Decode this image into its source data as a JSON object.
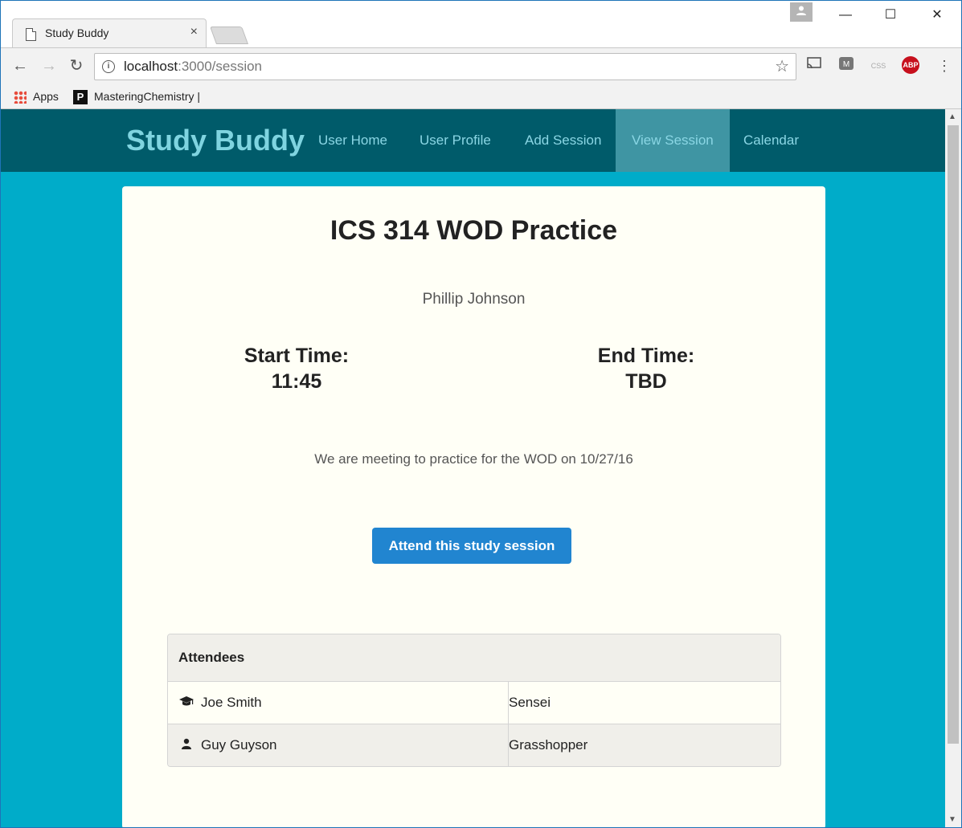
{
  "browser": {
    "tab_title": "Study Buddy",
    "tab_close": "×",
    "url_host": "localhost",
    "url_rest": ":3000/session",
    "window_controls": {
      "minimize": "—",
      "maximize": "☐",
      "close": "✕"
    },
    "bookmarks": [
      {
        "label": "Apps",
        "icon": "apps-grid-icon"
      },
      {
        "label": "MasteringChemistry |",
        "icon": "pearson-p-icon"
      }
    ],
    "extensions": {
      "abp_label": "ABP"
    }
  },
  "navbar": {
    "brand": "Study Buddy",
    "items": [
      {
        "label": "User Home",
        "active": false
      },
      {
        "label": "User Profile",
        "active": false
      },
      {
        "label": "Add Session",
        "active": false
      },
      {
        "label": "View Session",
        "active": true
      },
      {
        "label": "Calendar",
        "active": false
      }
    ],
    "colors": {
      "bar": "#005b6a",
      "active": "#3f95a3",
      "link": "#8ad6e4",
      "page_bg": "#00acc9"
    }
  },
  "session": {
    "title": "ICS 314 WOD Practice",
    "host": "Phillip Johnson",
    "start_label": "Start Time:",
    "start_value": "11:45",
    "end_label": "End Time:",
    "end_value": "TBD",
    "description": "We are meeting to practice for the WOD on 10/27/16",
    "attend_button": "Attend this study session"
  },
  "attendees": {
    "header": "Attendees",
    "rows": [
      {
        "name": "Joe Smith",
        "role": "Sensei",
        "icon": "graduation-cap-icon"
      },
      {
        "name": "Guy Guyson",
        "role": "Grasshopper",
        "icon": "user-icon"
      }
    ]
  }
}
